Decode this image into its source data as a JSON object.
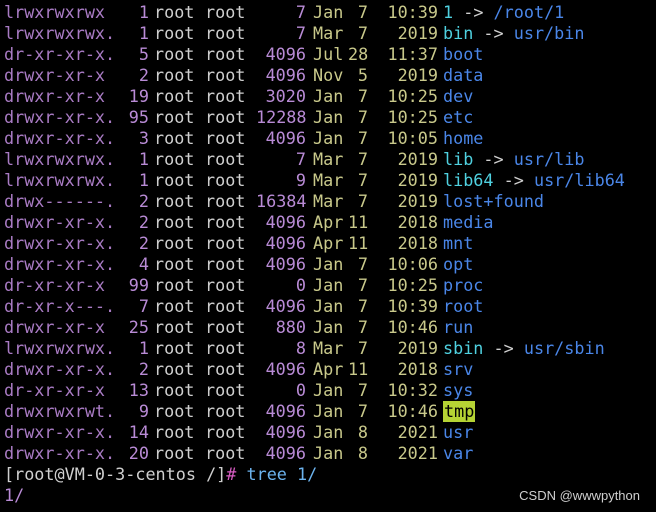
{
  "listing": [
    {
      "perm": "lrwxrwxrwx",
      "links": "1",
      "owner": "root",
      "group": "root",
      "size": "7",
      "month": "Jan",
      "day": "7",
      "time": "10:39",
      "name": "1",
      "kind": "link",
      "target": "/root/1"
    },
    {
      "perm": "lrwxrwxrwx.",
      "links": "1",
      "owner": "root",
      "group": "root",
      "size": "7",
      "month": "Mar",
      "day": "7",
      "time": "2019",
      "name": "bin",
      "kind": "link",
      "target": "usr/bin"
    },
    {
      "perm": "dr-xr-xr-x.",
      "links": "5",
      "owner": "root",
      "group": "root",
      "size": "4096",
      "month": "Jul",
      "day": "28",
      "time": "11:37",
      "name": "boot",
      "kind": "dir"
    },
    {
      "perm": "drwxr-xr-x",
      "links": "2",
      "owner": "root",
      "group": "root",
      "size": "4096",
      "month": "Nov",
      "day": "5",
      "time": "2019",
      "name": "data",
      "kind": "dir"
    },
    {
      "perm": "drwxr-xr-x",
      "links": "19",
      "owner": "root",
      "group": "root",
      "size": "3020",
      "month": "Jan",
      "day": "7",
      "time": "10:25",
      "name": "dev",
      "kind": "dir"
    },
    {
      "perm": "drwxr-xr-x.",
      "links": "95",
      "owner": "root",
      "group": "root",
      "size": "12288",
      "month": "Jan",
      "day": "7",
      "time": "10:25",
      "name": "etc",
      "kind": "dir"
    },
    {
      "perm": "drwxr-xr-x.",
      "links": "3",
      "owner": "root",
      "group": "root",
      "size": "4096",
      "month": "Jan",
      "day": "7",
      "time": "10:05",
      "name": "home",
      "kind": "dir"
    },
    {
      "perm": "lrwxrwxrwx.",
      "links": "1",
      "owner": "root",
      "group": "root",
      "size": "7",
      "month": "Mar",
      "day": "7",
      "time": "2019",
      "name": "lib",
      "kind": "link",
      "target": "usr/lib"
    },
    {
      "perm": "lrwxrwxrwx.",
      "links": "1",
      "owner": "root",
      "group": "root",
      "size": "9",
      "month": "Mar",
      "day": "7",
      "time": "2019",
      "name": "lib64",
      "kind": "link",
      "target": "usr/lib64"
    },
    {
      "perm": "drwx------.",
      "links": "2",
      "owner": "root",
      "group": "root",
      "size": "16384",
      "month": "Mar",
      "day": "7",
      "time": "2019",
      "name": "lost+found",
      "kind": "dir"
    },
    {
      "perm": "drwxr-xr-x.",
      "links": "2",
      "owner": "root",
      "group": "root",
      "size": "4096",
      "month": "Apr",
      "day": "11",
      "time": "2018",
      "name": "media",
      "kind": "dir"
    },
    {
      "perm": "drwxr-xr-x.",
      "links": "2",
      "owner": "root",
      "group": "root",
      "size": "4096",
      "month": "Apr",
      "day": "11",
      "time": "2018",
      "name": "mnt",
      "kind": "dir"
    },
    {
      "perm": "drwxr-xr-x.",
      "links": "4",
      "owner": "root",
      "group": "root",
      "size": "4096",
      "month": "Jan",
      "day": "7",
      "time": "10:06",
      "name": "opt",
      "kind": "dir"
    },
    {
      "perm": "dr-xr-xr-x",
      "links": "99",
      "owner": "root",
      "group": "root",
      "size": "0",
      "month": "Jan",
      "day": "7",
      "time": "10:25",
      "name": "proc",
      "kind": "dir"
    },
    {
      "perm": "dr-xr-x---.",
      "links": "7",
      "owner": "root",
      "group": "root",
      "size": "4096",
      "month": "Jan",
      "day": "7",
      "time": "10:39",
      "name": "root",
      "kind": "dir"
    },
    {
      "perm": "drwxr-xr-x",
      "links": "25",
      "owner": "root",
      "group": "root",
      "size": "880",
      "month": "Jan",
      "day": "7",
      "time": "10:46",
      "name": "run",
      "kind": "dir"
    },
    {
      "perm": "lrwxrwxrwx.",
      "links": "1",
      "owner": "root",
      "group": "root",
      "size": "8",
      "month": "Mar",
      "day": "7",
      "time": "2019",
      "name": "sbin",
      "kind": "link",
      "target": "usr/sbin"
    },
    {
      "perm": "drwxr-xr-x.",
      "links": "2",
      "owner": "root",
      "group": "root",
      "size": "4096",
      "month": "Apr",
      "day": "11",
      "time": "2018",
      "name": "srv",
      "kind": "dir"
    },
    {
      "perm": "dr-xr-xr-x",
      "links": "13",
      "owner": "root",
      "group": "root",
      "size": "0",
      "month": "Jan",
      "day": "7",
      "time": "10:32",
      "name": "sys",
      "kind": "dir"
    },
    {
      "perm": "drwxrwxrwt.",
      "links": "9",
      "owner": "root",
      "group": "root",
      "size": "4096",
      "month": "Jan",
      "day": "7",
      "time": "10:46",
      "name": "tmp",
      "kind": "sticky"
    },
    {
      "perm": "drwxr-xr-x.",
      "links": "14",
      "owner": "root",
      "group": "root",
      "size": "4096",
      "month": "Jan",
      "day": "8",
      "time": "2021",
      "name": "usr",
      "kind": "dir"
    },
    {
      "perm": "drwxr-xr-x.",
      "links": "20",
      "owner": "root",
      "group": "root",
      "size": "4096",
      "month": "Jan",
      "day": "8",
      "time": "2021",
      "name": "var",
      "kind": "dir"
    }
  ],
  "link_arrow": "->",
  "prompt": {
    "text": "[root@VM-0-3-centos /]",
    "symbol": "#",
    "command": "tree 1/"
  },
  "input_line": "1/",
  "watermark": "CSDN @wwwpython",
  "colors": {
    "background": "#000000",
    "permissions": "#a97bc4",
    "numbers": "#b98bd6",
    "date": "#c9c98b",
    "directory": "#4a86e8",
    "symlink": "#4fd1e0",
    "sticky_bg": "#b5d334",
    "prompt_hash": "#d85cc2",
    "command": "#6cb3ee"
  }
}
